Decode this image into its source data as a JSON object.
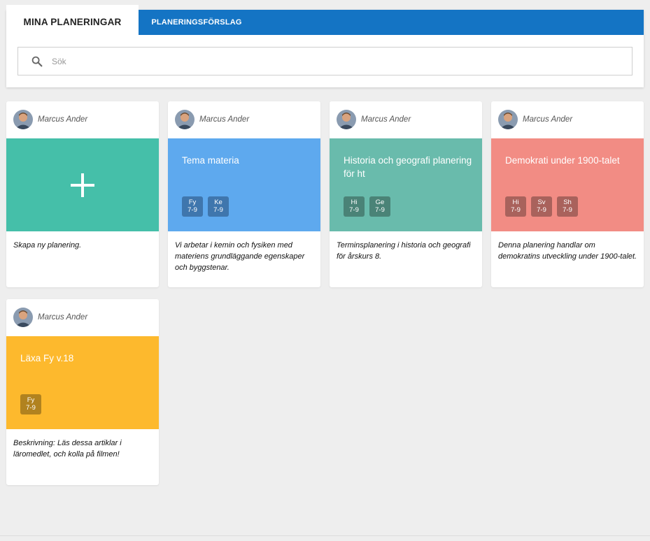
{
  "tabs": {
    "mine": "MINA PLANERINGAR",
    "suggestions": "PLANERINGSFÖRSLAG"
  },
  "search": {
    "placeholder": "Sök",
    "value": ""
  },
  "colors": {
    "tabbar": "#1474c4",
    "create": "#45bfa9",
    "tema": "#5ea9ee",
    "historia": "#69bbac",
    "demokrati": "#f28c84",
    "laxa": "#fdb92d"
  },
  "cards": [
    {
      "author": "Marcus Ander",
      "create_icon": "plus-icon",
      "description": "Skapa ny planering."
    },
    {
      "author": "Marcus Ander",
      "title": "Tema materia",
      "tags": [
        {
          "subject": "Fy",
          "grades": "7-9"
        },
        {
          "subject": "Ke",
          "grades": "7-9"
        }
      ],
      "description": "Vi arbetar i kemin och fysiken med materiens grundläggande egenskaper och byggstenar."
    },
    {
      "author": "Marcus Ander",
      "title": "Historia och geografi planering för ht",
      "tags": [
        {
          "subject": "Hi",
          "grades": "7-9"
        },
        {
          "subject": "Ge",
          "grades": "7-9"
        }
      ],
      "description": "Terminsplanering i historia och geografi för årskurs 8."
    },
    {
      "author": "Marcus Ander",
      "title": "Demokrati under 1900-talet",
      "tags": [
        {
          "subject": "Hi",
          "grades": "7-9"
        },
        {
          "subject": "Sv",
          "grades": "7-9"
        },
        {
          "subject": "Sh",
          "grades": "7-9"
        }
      ],
      "description": "Denna planering handlar om demokratins utveckling under 1900-talet."
    },
    {
      "author": "Marcus Ander",
      "title": "Läxa Fy v.18",
      "tags": [
        {
          "subject": "Fy",
          "grades": "7-9"
        }
      ],
      "description": "Beskrivning: Läs dessa artiklar i läromedlet, och kolla på filmen!"
    }
  ]
}
